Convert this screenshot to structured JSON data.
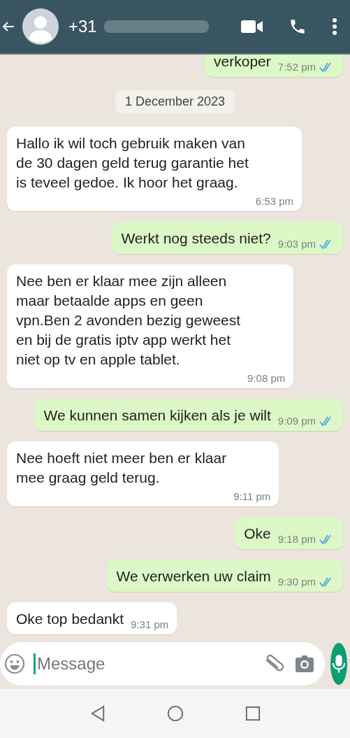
{
  "header": {
    "contact": "+31"
  },
  "messages": [
    {
      "kind": "outgoing",
      "text": "verkoper",
      "time": "7:52 pm",
      "read": true
    },
    {
      "kind": "date",
      "text": "1 December 2023"
    },
    {
      "kind": "incoming",
      "text": "Hallo ik wil toch gebruik maken van\nde 30 dagen geld terug garantie het\nis teveel gedoe. Ik hoor het graag.",
      "time": "6:53 pm"
    },
    {
      "kind": "outgoing",
      "text": "Werkt nog steeds niet?",
      "time": "9:03 pm",
      "read": true
    },
    {
      "kind": "incoming",
      "text": "Nee ben er klaar mee zijn alleen\nmaar betaalde apps en geen\nvpn.Ben 2 avonden bezig geweest\nen bij de gratis iptv app werkt het\nniet op tv en apple tablet.",
      "time": "9:08 pm"
    },
    {
      "kind": "outgoing",
      "text": "We kunnen samen kijken als je wilt",
      "time": "9:09 pm",
      "read": true
    },
    {
      "kind": "incoming",
      "text": "Nee hoeft niet meer ben er klaar\nmee graag geld terug.",
      "time": "9:11 pm"
    },
    {
      "kind": "outgoing",
      "text": "Oke",
      "time": "9:18 pm",
      "read": true
    },
    {
      "kind": "outgoing",
      "text": "We verwerken uw claim",
      "time": "9:30 pm",
      "read": true
    },
    {
      "kind": "incoming",
      "text": "Oke top bedankt",
      "time": "9:31 pm"
    }
  ],
  "composer": {
    "placeholder": "Message"
  }
}
